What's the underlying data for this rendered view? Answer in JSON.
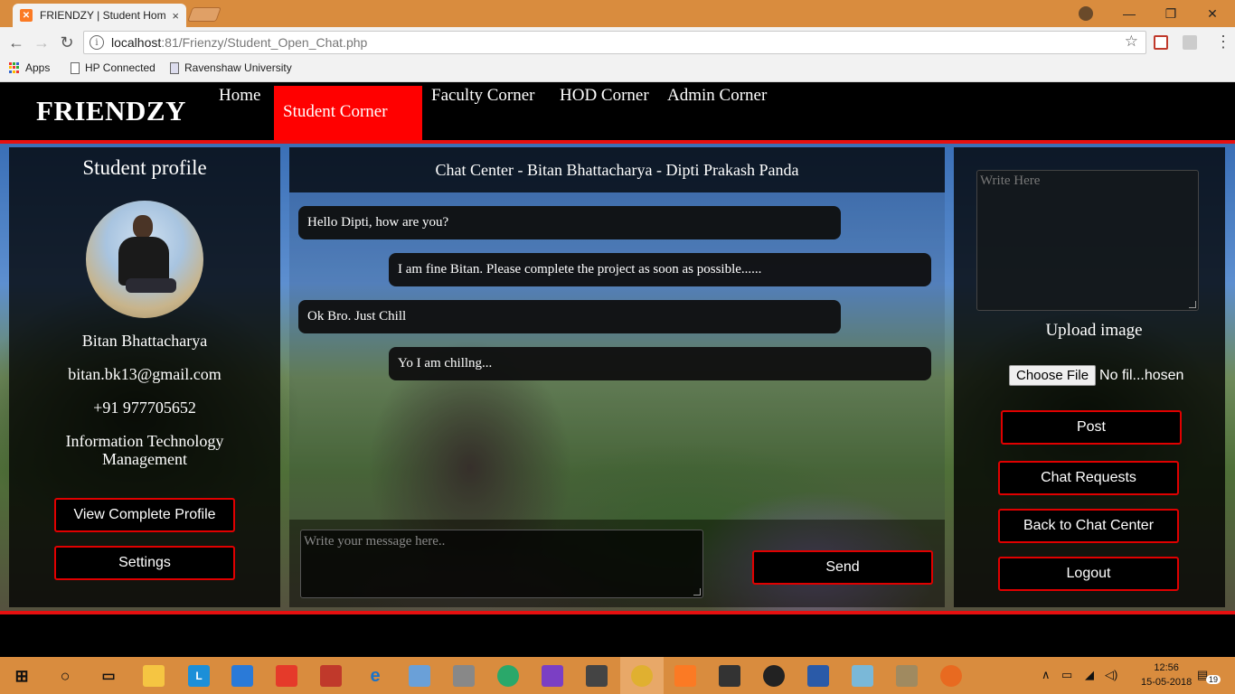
{
  "browser": {
    "tab_title": "FRIENDZY | Student Hom",
    "tab_close": "×",
    "url_host": "localhost",
    "url_path": ":81/Frienzy/Student_Open_Chat.php",
    "bookmarks": [
      "Apps",
      "HP Connected",
      "Ravenshaw University"
    ],
    "win_controls": {
      "minimize": "—",
      "restore": "❐",
      "close": "✕"
    }
  },
  "header": {
    "brand": "FRIENDZY",
    "nav": [
      "Home",
      "Student Corner",
      "Faculty Corner",
      "HOD Corner",
      "Admin Corner"
    ],
    "active_nav": "Student Corner"
  },
  "profile": {
    "title": "Student profile",
    "name": "Bitan Bhattacharya",
    "email": "bitan.bk13@gmail.com",
    "phone": "+91 977705652",
    "department": "Information Technology Management",
    "view_profile_label": "View Complete Profile",
    "settings_label": "Settings"
  },
  "chat": {
    "title": "Chat Center - Bitan Bhattacharya - Dipti Prakash Panda",
    "messages": [
      {
        "side": "left",
        "text": "Hello Dipti, how are you?"
      },
      {
        "side": "right",
        "text": "I am fine Bitan. Please complete the project as soon as possible......"
      },
      {
        "side": "left",
        "text": "Ok Bro. Just Chill"
      },
      {
        "side": "right",
        "text": "Yo I am chillng..."
      }
    ],
    "input_placeholder": "Write your message here..",
    "send_label": "Send"
  },
  "sidebar": {
    "post_placeholder": "Write Here",
    "upload_label": "Upload image",
    "choose_file_label": "Choose File",
    "file_status": "No fil...hosen",
    "post_label": "Post",
    "chat_requests_label": "Chat Requests",
    "back_label": "Back to Chat Center",
    "logout_label": "Logout"
  },
  "taskbar": {
    "time": "12:56",
    "date": "15-05-2018",
    "notification_count": "19"
  },
  "colors": {
    "accent_red": "#ff0000",
    "chrome_orange": "#d98c3e"
  }
}
